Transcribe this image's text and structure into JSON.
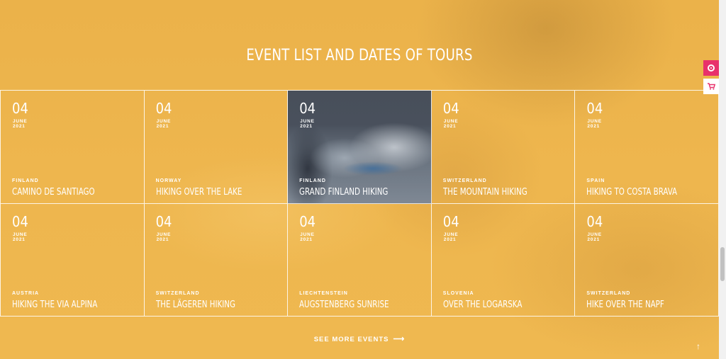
{
  "section": {
    "title": "EVENT LIST AND DATES OF TOURS",
    "see_more_label": "SEE MORE EVENTS",
    "see_more_icon": "arrow-right-icon",
    "back_to_top_icon": "arrow-up-icon"
  },
  "side_buttons": [
    {
      "icon": "support-ring-icon",
      "color": "#e8316b"
    },
    {
      "icon": "cart-icon",
      "color": "#e8316b"
    }
  ],
  "events": [
    {
      "day": "04",
      "month": "JUNE",
      "year": "2021",
      "country": "FINLAND",
      "name": "CAMINO DE SANTIAGO"
    },
    {
      "day": "04",
      "month": "JUNE",
      "year": "2021",
      "country": "NORWAY",
      "name": "HIKING OVER THE LAKE"
    },
    {
      "day": "04",
      "month": "JUNE",
      "year": "2021",
      "country": "FINLAND",
      "name": "GRAND FINLAND HIKING",
      "active": true
    },
    {
      "day": "04",
      "month": "JUNE",
      "year": "2021",
      "country": "SWITZERLAND",
      "name": "THE MOUNTAIN HIKING"
    },
    {
      "day": "04",
      "month": "JUNE",
      "year": "2021",
      "country": "SPAIN",
      "name": "HIKING TO COSTA BRAVA"
    },
    {
      "day": "04",
      "month": "JUNE",
      "year": "2021",
      "country": "AUSTRIA",
      "name": "HIKING THE VIA ALPINA"
    },
    {
      "day": "04",
      "month": "JUNE",
      "year": "2021",
      "country": "SWITZERLAND",
      "name": "THE LÄGEREN HIKING"
    },
    {
      "day": "04",
      "month": "JUNE",
      "year": "2021",
      "country": "LIECHTENSTEIN",
      "name": "AUGSTENBERG SUNRISE"
    },
    {
      "day": "04",
      "month": "JUNE",
      "year": "2021",
      "country": "SLOVENIA",
      "name": "OVER THE LOGARSKA"
    },
    {
      "day": "04",
      "month": "JUNE",
      "year": "2021",
      "country": "SWITZERLAND",
      "name": "HIKE OVER THE NAPF"
    }
  ],
  "colors": {
    "background": "#eeb64d",
    "active_card": "#3f4652",
    "accent": "#e8316b"
  }
}
